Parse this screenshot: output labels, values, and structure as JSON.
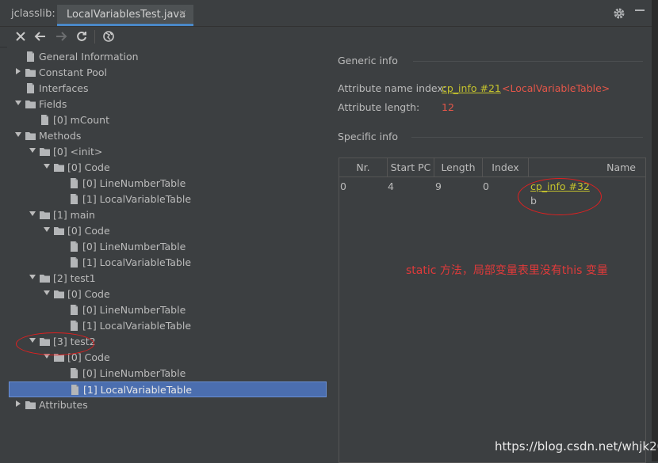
{
  "tabbar": {
    "tool_label": "jclasslib:",
    "tab_label": "LocalVariablesTest.java",
    "tab_close": "×"
  },
  "icons": {
    "settings": "gear-icon",
    "minimize": "minimize-icon",
    "close": "close-icon",
    "back": "arrow-left-icon",
    "forward": "arrow-right-icon",
    "reload": "refresh-icon",
    "browser": "globe-icon",
    "folder": "folder-icon",
    "file": "file-icon"
  },
  "tree": [
    {
      "label": "General Information",
      "level": 1,
      "type": "file",
      "arrow": "none"
    },
    {
      "label": "Constant Pool",
      "level": 1,
      "type": "folder",
      "arrow": "collapsed"
    },
    {
      "label": "Interfaces",
      "level": 1,
      "type": "file",
      "arrow": "none"
    },
    {
      "label": "Fields",
      "level": 1,
      "type": "folder",
      "arrow": "expanded"
    },
    {
      "label": "[0] mCount",
      "level": 2,
      "type": "file",
      "arrow": "none"
    },
    {
      "label": "Methods",
      "level": 1,
      "type": "folder",
      "arrow": "expanded"
    },
    {
      "label": "[0] <init>",
      "level": 2,
      "type": "folder",
      "arrow": "expanded"
    },
    {
      "label": "[0] Code",
      "level": 3,
      "type": "folder",
      "arrow": "expanded"
    },
    {
      "label": "[0] LineNumberTable",
      "level": 4,
      "type": "file",
      "arrow": "none"
    },
    {
      "label": "[1] LocalVariableTable",
      "level": 4,
      "type": "file",
      "arrow": "none"
    },
    {
      "label": "[1] main",
      "level": 2,
      "type": "folder",
      "arrow": "expanded"
    },
    {
      "label": "[0] Code",
      "level": 3,
      "type": "folder",
      "arrow": "expanded"
    },
    {
      "label": "[0] LineNumberTable",
      "level": 4,
      "type": "file",
      "arrow": "none"
    },
    {
      "label": "[1] LocalVariableTable",
      "level": 4,
      "type": "file",
      "arrow": "none"
    },
    {
      "label": "[2] test1",
      "level": 2,
      "type": "folder",
      "arrow": "expanded"
    },
    {
      "label": "[0] Code",
      "level": 3,
      "type": "folder",
      "arrow": "expanded"
    },
    {
      "label": "[0] LineNumberTable",
      "level": 4,
      "type": "file",
      "arrow": "none"
    },
    {
      "label": "[1] LocalVariableTable",
      "level": 4,
      "type": "file",
      "arrow": "none"
    },
    {
      "label": "[3] test2",
      "level": 2,
      "type": "folder",
      "arrow": "expanded"
    },
    {
      "label": "[0] Code",
      "level": 3,
      "type": "folder",
      "arrow": "expanded"
    },
    {
      "label": "[0] LineNumberTable",
      "level": 4,
      "type": "file",
      "arrow": "none"
    },
    {
      "label": "[1] LocalVariableTable",
      "level": 4,
      "type": "file",
      "arrow": "none",
      "selected": true
    },
    {
      "label": "Attributes",
      "level": 1,
      "type": "folder",
      "arrow": "collapsed"
    }
  ],
  "detail": {
    "generic_title": "Generic info",
    "attr_name_key": "Attribute name index:",
    "attr_name_link": "cp_info #21",
    "attr_name_value": "<LocalVariableTable>",
    "attr_length_key": "Attribute length:",
    "attr_length_value": "12",
    "specific_title": "Specific info",
    "table": {
      "headers": [
        "Nr.",
        "Start PC",
        "Length",
        "Index",
        "Name"
      ],
      "rows": [
        {
          "nr": "0",
          "start_pc": "4",
          "length": "9",
          "index": "0",
          "name_link": "cp_info #32",
          "name_value": "b"
        }
      ]
    },
    "annotation": "static 方法，局部变量表里没有this 变量"
  },
  "watermark": "https://blog.csdn.net/whjk20",
  "colors": {
    "background": "#3c3f41",
    "selection": "#4b6eaf",
    "link": "#c6c42d",
    "value_red": "#e45649",
    "annotation_red": "#e03a3a"
  }
}
